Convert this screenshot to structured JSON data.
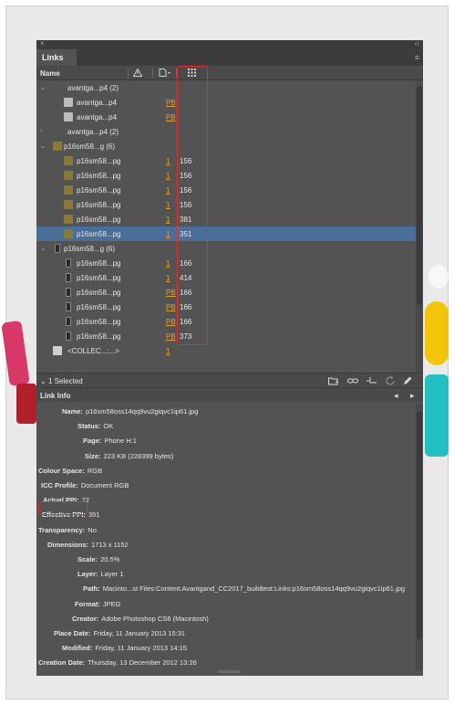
{
  "panel": {
    "close_glyph": "×",
    "collapse_glyph": "‹‹",
    "tab_label": "Links",
    "menu_glyph": "≡"
  },
  "columns": {
    "name": "Name",
    "warning_icon": "warning-icon",
    "page_icon": "page-icon",
    "ppi_icon": "grid-icon"
  },
  "links": [
    {
      "twisty": "⌄",
      "thumb": "none",
      "name": "avantga...p4 (2)",
      "page": "",
      "ppi": ""
    },
    {
      "twisty": "",
      "thumb": "doc",
      "name": "avantga...p4",
      "page": "PB",
      "ppi": ""
    },
    {
      "twisty": "",
      "thumb": "doc",
      "name": "avantga...p4",
      "page": "PB",
      "ppi": ""
    },
    {
      "twisty": "›",
      "thumb": "none",
      "name": "avantga...p4 (2)",
      "page": "",
      "ppi": ""
    },
    {
      "twisty": "⌄",
      "thumb": "photo",
      "name": "p16sm58...g (6)",
      "page": "",
      "ppi": ""
    },
    {
      "twisty": "",
      "thumb": "photo",
      "name": "p16sm58...pg",
      "page": "1",
      "ppi": "156"
    },
    {
      "twisty": "",
      "thumb": "photo",
      "name": "p16sm58...pg",
      "page": "1",
      "ppi": "156"
    },
    {
      "twisty": "",
      "thumb": "photo",
      "name": "p16sm58...pg",
      "page": "1",
      "ppi": "156"
    },
    {
      "twisty": "",
      "thumb": "photo",
      "name": "p16sm58...pg",
      "page": "1",
      "ppi": "156"
    },
    {
      "twisty": "",
      "thumb": "photo",
      "name": "p16sm58...pg",
      "page": "1",
      "ppi": "381"
    },
    {
      "twisty": "",
      "thumb": "photo",
      "name": "p16sm58...pg",
      "page": "1",
      "ppi": "351",
      "selected": true
    },
    {
      "twisty": "⌄",
      "thumb": "phone",
      "name": "p16sm58...g (6)",
      "page": "",
      "ppi": ""
    },
    {
      "twisty": "",
      "thumb": "phone",
      "name": "p16sm58...pg",
      "page": "1",
      "ppi": "166"
    },
    {
      "twisty": "",
      "thumb": "phone",
      "name": "p16sm58...pg",
      "page": "1",
      "ppi": "414"
    },
    {
      "twisty": "",
      "thumb": "phone",
      "name": "p16sm58...pg",
      "page": "PB",
      "ppi": "166"
    },
    {
      "twisty": "",
      "thumb": "phone",
      "name": "p16sm58...pg",
      "page": "PB",
      "ppi": "166"
    },
    {
      "twisty": "",
      "thumb": "phone",
      "name": "p16sm58...pg",
      "page": "PB",
      "ppi": "166"
    },
    {
      "twisty": "",
      "thumb": "phone",
      "name": "p16sm58...pg",
      "page": "PB",
      "ppi": "373"
    },
    {
      "twisty": "",
      "thumb": "file",
      "name": "<COLLEC...:...>",
      "page": "1",
      "ppi": ""
    }
  ],
  "status": {
    "selected_label": "1 Selected",
    "icons": [
      "relink-to-folder-icon",
      "link-icon",
      "go-to-link-icon",
      "update-link-icon",
      "edit-original-icon"
    ]
  },
  "link_info": {
    "header": "Link Info",
    "prev_glyph": "◂",
    "next_glyph": "▸",
    "fields": [
      {
        "label": "Name:",
        "value": "p16sm58oss14qq9vu2giqvc1ip61.jpg",
        "indent": 26
      },
      {
        "label": "Status:",
        "value": "OK",
        "indent": 43
      },
      {
        "label": "Page:",
        "value": "Phone H:1",
        "indent": 49
      },
      {
        "label": "Size:",
        "value": "223 KB (228399 bytes)",
        "indent": 51
      },
      {
        "label": "Colour Space:",
        "value": "RGB",
        "indent": 0
      },
      {
        "label": "ICC Profile:",
        "value": "Document RGB",
        "indent": 3
      },
      {
        "label": "Actual PPI:",
        "value": "72",
        "indent": 5
      },
      {
        "label": "Effective PPI:",
        "value": "351",
        "indent": 4
      },
      {
        "label": "Transparency:",
        "value": "No",
        "indent": 0
      },
      {
        "label": "Dimensions:",
        "value": "1713 x 1152",
        "indent": 10
      },
      {
        "label": "Scale:",
        "value": "20.5%",
        "indent": 43
      },
      {
        "label": "Layer:",
        "value": "Layer 1",
        "indent": 43
      },
      {
        "label": "Path:",
        "value": "Macinto...st Files:Content:Avantgand_CC2017_buildtest:Links:p16sm58oss14qq9vu2giqvc1ip61.jpg",
        "indent": 49
      },
      {
        "label": "Format:",
        "value": "JPEG",
        "indent": 40
      },
      {
        "label": "Creator:",
        "value": "Adobe Photoshop CS6 (Macintosh)",
        "indent": 37
      },
      {
        "label": "Place Date:",
        "value": "Friday, 11 January 2013 15:31",
        "indent": 17
      },
      {
        "label": "Modified:",
        "value": "Friday, 11 January 2013 14:15",
        "indent": 26
      },
      {
        "label": "Creation Date:",
        "value": "Thursday, 13 December 2012 13:26",
        "indent": 0
      }
    ]
  },
  "colors": {
    "panel_bg": "#535353",
    "selection": "#4b6e99",
    "highlight_red": "#e03030",
    "page_link_orange": "#e0a040"
  }
}
